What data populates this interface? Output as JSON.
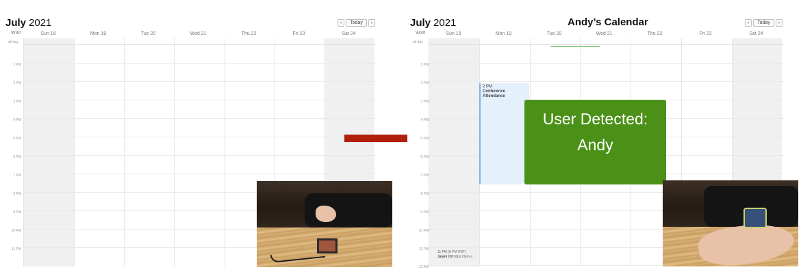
{
  "left_calendar": {
    "month": "July",
    "year": "2021",
    "nav": {
      "prev": "‹",
      "today": "Today",
      "next": "›"
    },
    "week": "W30",
    "days": [
      "Sun 18",
      "Mon 19",
      "Tue 20",
      "Wed 21",
      "Thu 22",
      "Fri 23",
      "Sat 24"
    ],
    "allday_label": "all-day",
    "hours": [
      "1 PM",
      "2 PM",
      "3 PM",
      "4 PM",
      "5 PM",
      "6 PM",
      "7 PM",
      "8 PM",
      "9 PM",
      "10 PM",
      "11 PM"
    ]
  },
  "right_calendar": {
    "month": "July",
    "year": "2021",
    "title": "Andy’s Calendar",
    "nav": {
      "prev": "‹",
      "today": "Today",
      "next": "›"
    },
    "week": "W30",
    "days": [
      "Sun 18",
      "Mon 19",
      "Tue 20",
      "Wed 21",
      "Thu 22",
      "Fri 23",
      "Sat 24"
    ],
    "allday_label": "all-day",
    "hours": [
      "1 PM",
      "2 PM",
      "3 PM",
      "4 PM",
      "5 PM",
      "6 PM",
      "7 PM",
      "8 PM",
      "9 PM",
      "10 PM",
      "11 PM",
      "12 AM"
    ],
    "event": {
      "time": "2 PM",
      "name": "Conference Attendance"
    },
    "event_bottom": {
      "time": "11 PM (8 PM PDT)",
      "who": "Jalani Oil",
      "link": "https://tomu..."
    }
  },
  "overlay": {
    "line1": "User Detected:",
    "line2": "Andy"
  },
  "colors": {
    "overlay_green": "#4b9118",
    "arrow_red": "#b01e0c",
    "event_blue": "#e4f0fb"
  }
}
